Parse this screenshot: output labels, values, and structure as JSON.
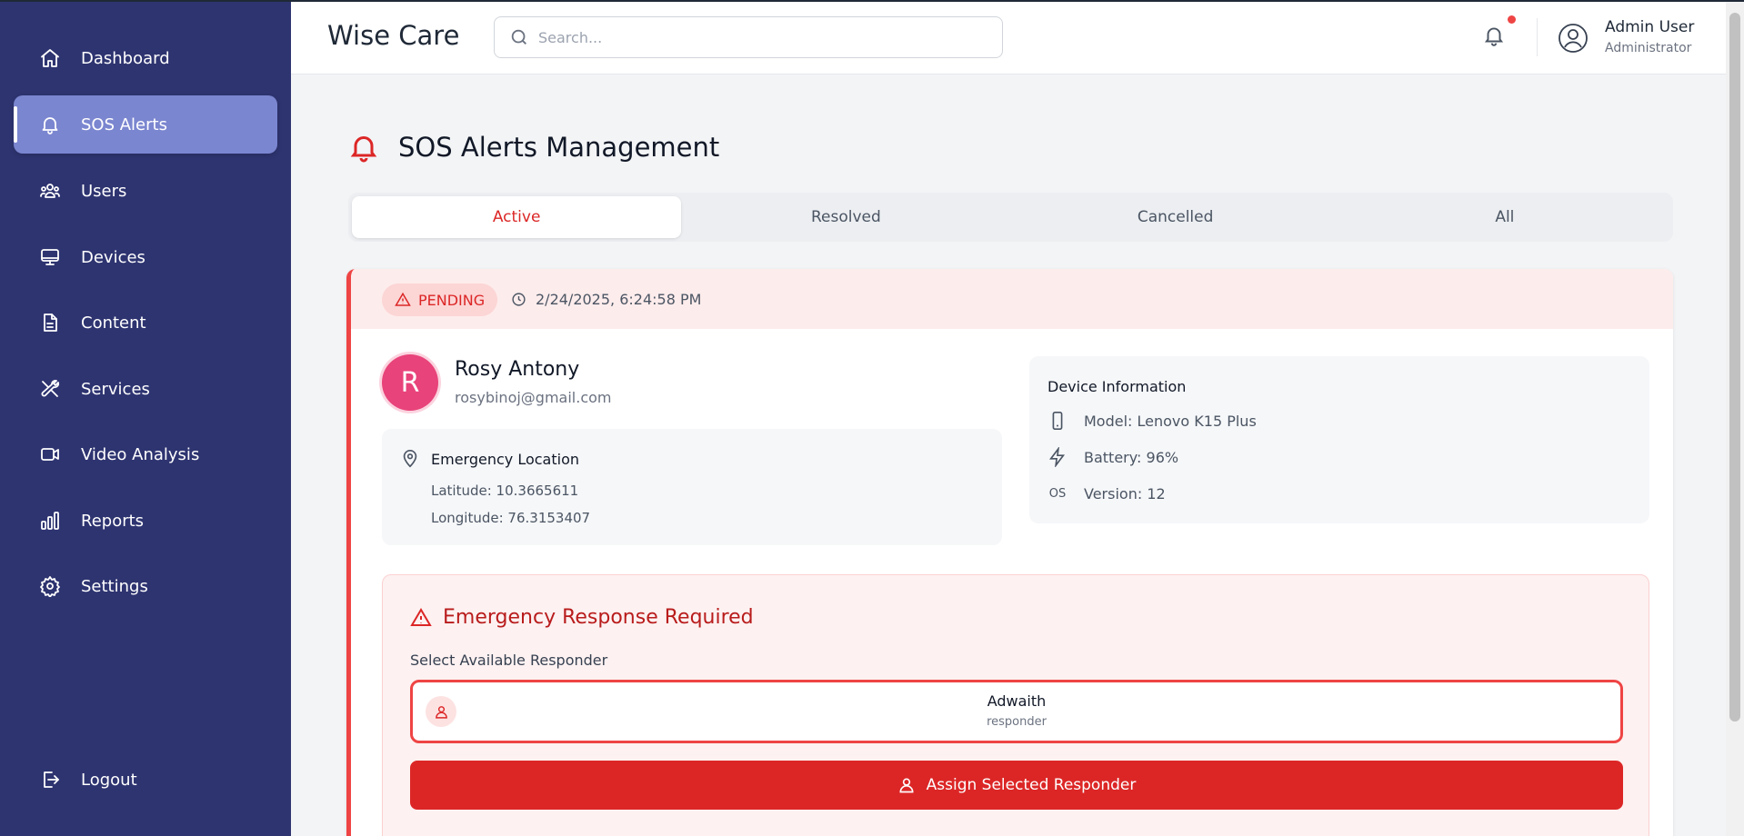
{
  "app": {
    "title": "Wise Care"
  },
  "search": {
    "placeholder": "Search..."
  },
  "user": {
    "name": "Admin User",
    "role": "Administrator"
  },
  "sidebar": {
    "items": [
      {
        "label": "Dashboard",
        "icon": "home-icon"
      },
      {
        "label": "SOS Alerts",
        "icon": "bell-icon",
        "active": true
      },
      {
        "label": "Users",
        "icon": "users-icon"
      },
      {
        "label": "Devices",
        "icon": "monitor-icon"
      },
      {
        "label": "Content",
        "icon": "file-icon"
      },
      {
        "label": "Services",
        "icon": "tools-icon"
      },
      {
        "label": "Video Analysis",
        "icon": "video-icon"
      },
      {
        "label": "Reports",
        "icon": "bar-chart-icon"
      },
      {
        "label": "Settings",
        "icon": "gear-icon"
      }
    ],
    "logout": {
      "label": "Logout",
      "icon": "logout-icon"
    }
  },
  "page": {
    "title": "SOS Alerts Management"
  },
  "tabs": [
    {
      "label": "Active",
      "active": true
    },
    {
      "label": "Resolved"
    },
    {
      "label": "Cancelled"
    },
    {
      "label": "All"
    }
  ],
  "alert": {
    "status": "PENDING",
    "timestamp": "2/24/2025, 6:24:58 PM",
    "person": {
      "initial": "R",
      "name": "Rosy Antony",
      "email": "rosybinoj@gmail.com"
    },
    "location": {
      "title": "Emergency Location",
      "latitude": "Latitude: 10.3665611",
      "longitude": "Longitude: 76.3153407"
    },
    "device": {
      "title": "Device Information",
      "model": "Model: Lenovo K15 Plus",
      "battery": "Battery: 96%",
      "os_icon": "OS",
      "version": "Version: 12"
    },
    "response": {
      "title": "Emergency Response Required",
      "select_label": "Select Available Responder",
      "responder": {
        "name": "Adwaith",
        "role": "responder"
      },
      "assign_label": "Assign Selected Responder"
    }
  },
  "colors": {
    "sidebar_bg": "#2e3470",
    "sidebar_active": "#7b86d0",
    "accent_red": "#dc2626",
    "avatar_pink": "#e8437a"
  }
}
